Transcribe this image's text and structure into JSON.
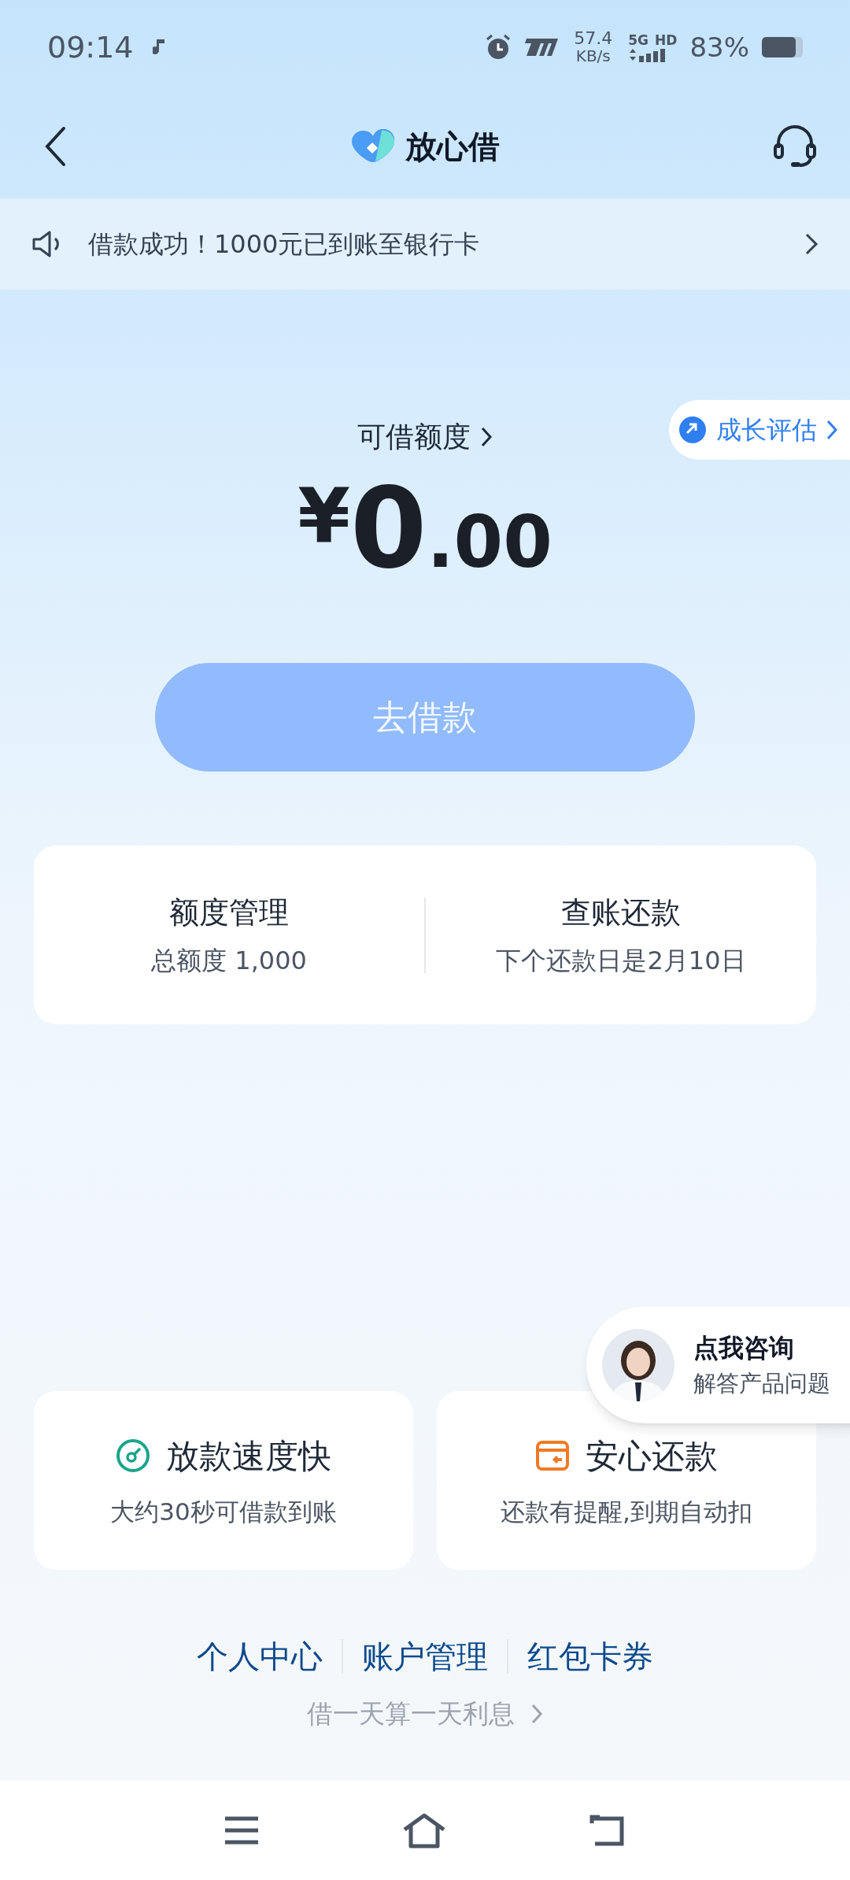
{
  "status_bar": {
    "time": "09:14",
    "speed": "57.4",
    "speed_unit": "KB/s",
    "network": "5G",
    "hd": "HD",
    "battery": "83%"
  },
  "header": {
    "title": "放心借"
  },
  "notice": {
    "text": "借款成功！1000元已到账至银行卡"
  },
  "credit": {
    "label": "可借额度",
    "currency": "¥",
    "integer": "0",
    "decimal": ".00",
    "growth_badge": "成长评估"
  },
  "borrow_button": {
    "label": "去借款",
    "disabled": true
  },
  "summary_cards": [
    {
      "title": "额度管理",
      "subtitle": "总额度 1,000"
    },
    {
      "title": "查账还款",
      "subtitle": "下个还款日是2月10日"
    }
  ],
  "consult": {
    "title": "点我咨询",
    "subtitle": "解答产品问题"
  },
  "features": [
    {
      "kind": "speed",
      "title": "放款速度快",
      "subtitle": "大约30秒可借款到账"
    },
    {
      "kind": "repay",
      "title": "安心还款",
      "subtitle": "还款有提醒,到期自动扣"
    }
  ],
  "links": [
    "个人中心",
    "账户管理",
    "红包卡券"
  ],
  "interest_note": "借一天算一天利息"
}
